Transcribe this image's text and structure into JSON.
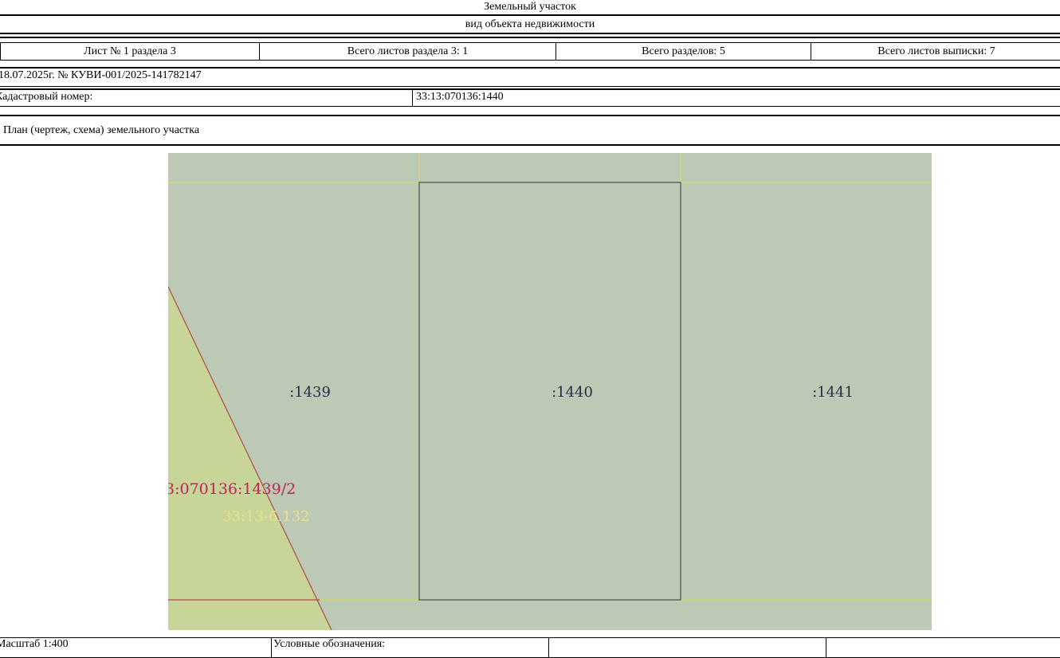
{
  "header": {
    "title": "Земельный участок",
    "subtitle": "вид объекта недвижимости"
  },
  "sheet_info": {
    "sheet": "Лист № 1 раздела 3",
    "sheets_in_section": "Всего листов раздела 3: 1",
    "sections_total": "Всего разделов: 5",
    "sheets_total": "Всего листов выписки: 7"
  },
  "extract": {
    "date_number": "18.07.2025г. № КУВИ-001/2025-141782147",
    "cadastral_label": "Кадастровый номер:",
    "cadastral_value": "33:13:070136:1440"
  },
  "plan_title": "План (чертеж, схема) земельного участка",
  "map": {
    "background": "#bcc9b5",
    "zone_fill": "#c8d598",
    "parcel_border": "#555555",
    "grid_line": "#d9e05a",
    "boundary_line": "#b04a4a",
    "parcels": [
      {
        "label": ":1439"
      },
      {
        "label": ":1440"
      },
      {
        "label": ":1441"
      }
    ],
    "part_label": "3:070136:1439/2",
    "zone_label": "33:13-6.132",
    "part_label_color": "#c0245a",
    "zone_label_color": "#e8e08a",
    "parcel_label_color": "#2c2c4a"
  },
  "footer": {
    "scale": "Масштаб 1:400",
    "legend": "Условные обозначения:"
  }
}
